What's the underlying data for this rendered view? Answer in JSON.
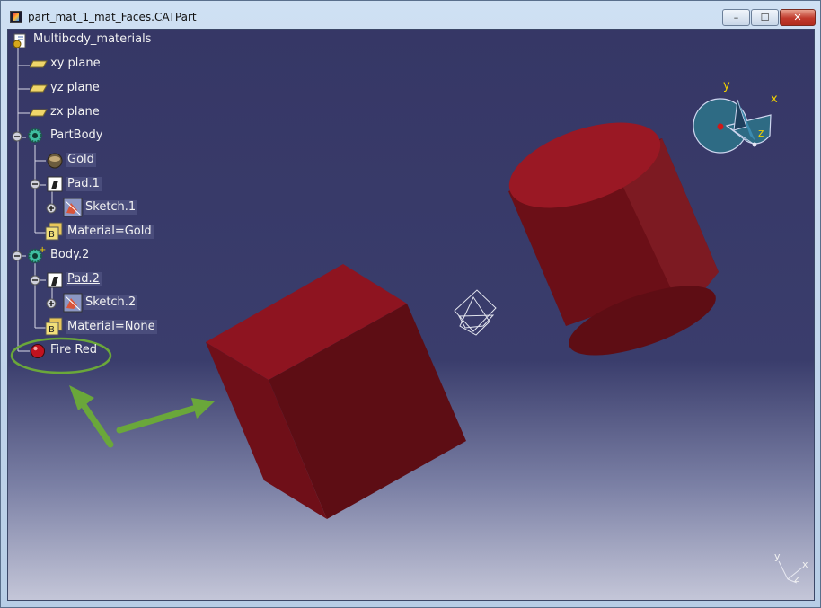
{
  "window": {
    "title": "part_mat_1_mat_Faces.CATPart",
    "controls": {
      "minimize": "–",
      "maximize": "☐",
      "close": "✕"
    }
  },
  "tree": {
    "root": "Multibody_materials",
    "planes": [
      "xy plane",
      "yz plane",
      "zx plane"
    ],
    "partbody": {
      "label": "PartBody",
      "material": "Gold",
      "pad": "Pad.1",
      "sketch": "Sketch.1",
      "material_param": "Material=Gold"
    },
    "body2": {
      "label": "Body.2",
      "pad": "Pad.2",
      "sketch": "Sketch.2",
      "material_param": "Material=None"
    },
    "material": "Fire Red"
  },
  "compass": {
    "x": "x",
    "y": "y",
    "z": "z"
  },
  "axis_triad": {
    "x": "x",
    "y": "y",
    "z": "z"
  },
  "colors": {
    "viewport_top": "#363766",
    "solid_red": "#8f1520",
    "highlight_green": "#6aa73a",
    "tree_text": "#f2f2f2"
  }
}
